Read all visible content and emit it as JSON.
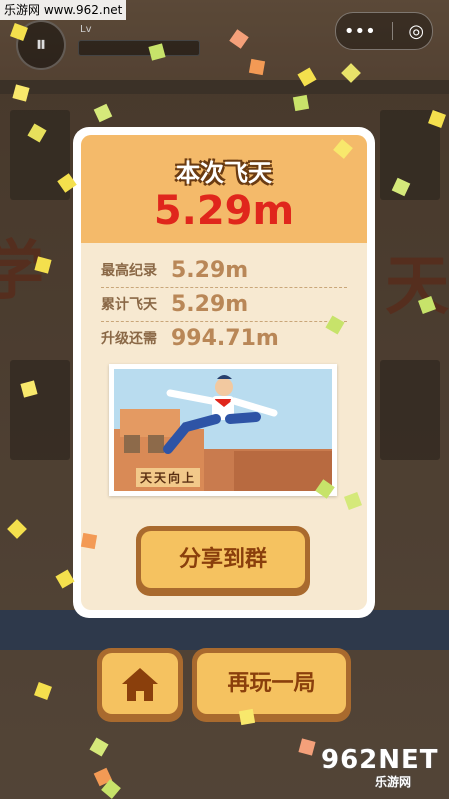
{
  "watermark": {
    "text": "乐游网 www.962.net"
  },
  "hud": {
    "pause_symbol": "⏸",
    "progress_label": "Lv",
    "more_symbol": "•••",
    "target_symbol": "◎"
  },
  "result_card": {
    "title": "本次飞天",
    "distance": "5.29m",
    "stats": [
      {
        "label": "最高纪录",
        "value": "5.29m"
      },
      {
        "label": "累计飞天",
        "value": "5.29m"
      },
      {
        "label": "升级还需",
        "value": "994.71m"
      }
    ],
    "photo_sign": "天天向上",
    "share_label": "分享到群"
  },
  "buttons": {
    "home_icon": "home-icon",
    "replay_label": "再玩一局"
  },
  "logo": {
    "main": "962NET",
    "sub": "乐游网"
  },
  "colors": {
    "card_header": "#f4ba6a",
    "distance": "#e0261c",
    "button": "#f5c260",
    "button_text": "#8a3f0c"
  }
}
